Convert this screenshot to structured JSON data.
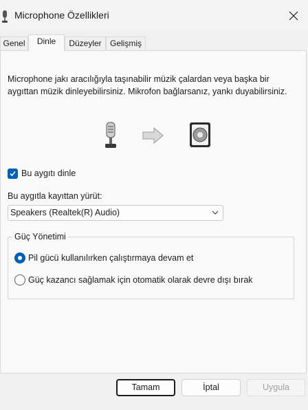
{
  "window": {
    "title": "Microphone Özellikleri"
  },
  "tabs": [
    {
      "label": "Genel",
      "active": false
    },
    {
      "label": "Dinle",
      "active": true
    },
    {
      "label": "Düzeyler",
      "active": false
    },
    {
      "label": "Gelişmiş",
      "active": false
    }
  ],
  "listen": {
    "description": "Microphone jakı aracılığıyla taşınabilir müzik çalardan veya başka bir aygıttan müzik dinleyebilirsiniz. Mikrofon bağlarsanız, yankı duyabilirsiniz.",
    "listen_checkbox_label": "Bu aygıtı dinle",
    "listen_checked": true,
    "playback_label": "Bu aygıtla kayıttan yürüt:",
    "playback_device": "Speakers (Realtek(R) Audio)"
  },
  "power": {
    "group_title": "Güç Yönetimi",
    "option_continue": "Pil gücü kullanılırken çalıştırmaya devam et",
    "option_disable": "Güç kazancı sağlamak için otomatik olarak devre dışı bırak",
    "selected": "option_continue"
  },
  "buttons": {
    "ok": "Tamam",
    "cancel": "İptal",
    "apply": "Uygula"
  },
  "colors": {
    "accent": "#005fb8"
  },
  "icons": [
    "microphone-icon",
    "close-icon",
    "arrow-right-icon",
    "speaker-icon",
    "checkmark-icon",
    "chevron-down-icon"
  ]
}
